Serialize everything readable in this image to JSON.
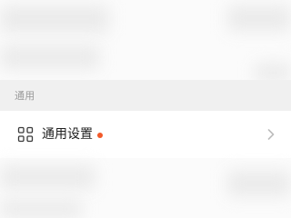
{
  "section": {
    "title": "通用"
  },
  "row": {
    "label": "通用设置",
    "icon": "grid-icon",
    "badge_color": "#f25a2a"
  },
  "theme": {
    "background": "#f1f1f1",
    "row_background": "#ffffff",
    "section_text_color": "#9a9a9a",
    "text_color": "#1f1f1f"
  }
}
